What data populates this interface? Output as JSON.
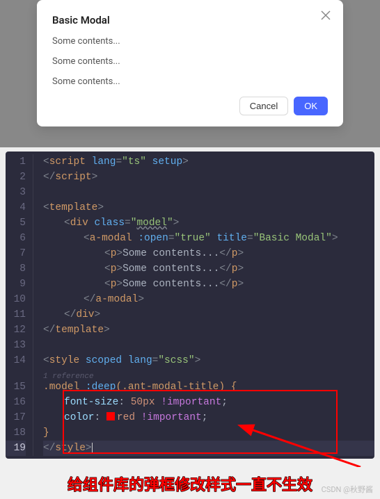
{
  "modal": {
    "title": "Basic Modal",
    "content1": "Some contents...",
    "content2": "Some contents...",
    "content3": "Some contents...",
    "cancel": "Cancel",
    "ok": "OK"
  },
  "editor": {
    "ref_text": "1 reference",
    "lines": {
      "l1a": "script",
      "l1_attr1": "lang",
      "l1_val1": "\"ts\"",
      "l1_attr2": "setup",
      "l2a": "script",
      "l4a": "template",
      "l5a": "div",
      "l5_attr1": "class",
      "l5_val1": "\"model\"",
      "l6a": "a-modal",
      "l6_attr1": ":open",
      "l6_val1": "\"true\"",
      "l6_attr2": "title",
      "l6_val2": "\"Basic Modal\"",
      "l7a": "p",
      "l7_txt": "Some contents...",
      "l8a": "p",
      "l8_txt": "Some contents...",
      "l9a": "p",
      "l9_txt": "Some contents...",
      "l10a": "a-modal",
      "l11a": "div",
      "l12a": "template",
      "l14a": "style",
      "l14_attr1": "scoped",
      "l14_attr2": "lang",
      "l14_val2": "\"scss\"",
      "l15_sel1": ".model ",
      "l15_sel2": ":deep",
      "l15_sel3": "(.ant-modal-title) {",
      "l16_prop": "font-size",
      "l16_val": "50px",
      "l16_imp": "!important",
      "l17_prop": "color",
      "l17_val": "red",
      "l17_imp": "!important",
      "l18": "}",
      "l19a": "style"
    }
  },
  "caption": "给组件库的弹框修改样式一直不生效",
  "watermark": "CSDN @秋野酱"
}
